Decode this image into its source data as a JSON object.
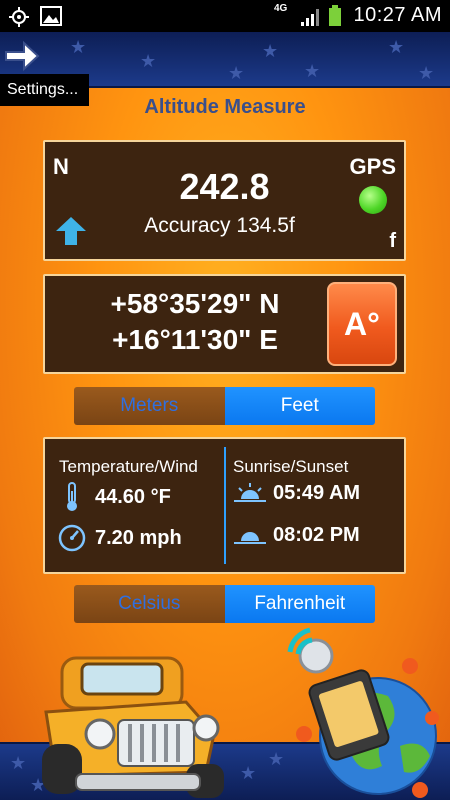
{
  "status_bar": {
    "network": "4G",
    "time": "10:27 AM",
    "icons": [
      "gps-icon",
      "gallery-icon",
      "signal-icon",
      "battery-icon"
    ]
  },
  "toolbar": {
    "settings_label": "Settings..."
  },
  "app_title": "Altitude Measure",
  "altitude_panel": {
    "north_label": "N",
    "gps_label": "GPS",
    "altitude_value": "242.8",
    "accuracy_text": "Accuracy 134.5f",
    "unit_label": "f",
    "gps_status_color": "#4ed627"
  },
  "coordinates_panel": {
    "latitude": "+58°35'29\" N",
    "longitude": "+16°11'30\" E",
    "format_button_label": "A°"
  },
  "distance_units": {
    "options": [
      "Meters",
      "Feet"
    ],
    "selected": "Feet"
  },
  "weather_panel": {
    "left_title": "Temperature/Wind",
    "temperature": "44.60 °F",
    "wind": "7.20 mph",
    "right_title": "Sunrise/Sunset",
    "sunrise": "05:49 AM",
    "sunset": "08:02 PM"
  },
  "temperature_units": {
    "options": [
      "Celsius",
      "Fahrenheit"
    ],
    "selected": "Fahrenheit"
  },
  "colors": {
    "background_orange": "#ff9410",
    "panel_brown": "#3d2410",
    "accent_blue": "#0a78f0",
    "button_orange": "#f05a1e"
  }
}
